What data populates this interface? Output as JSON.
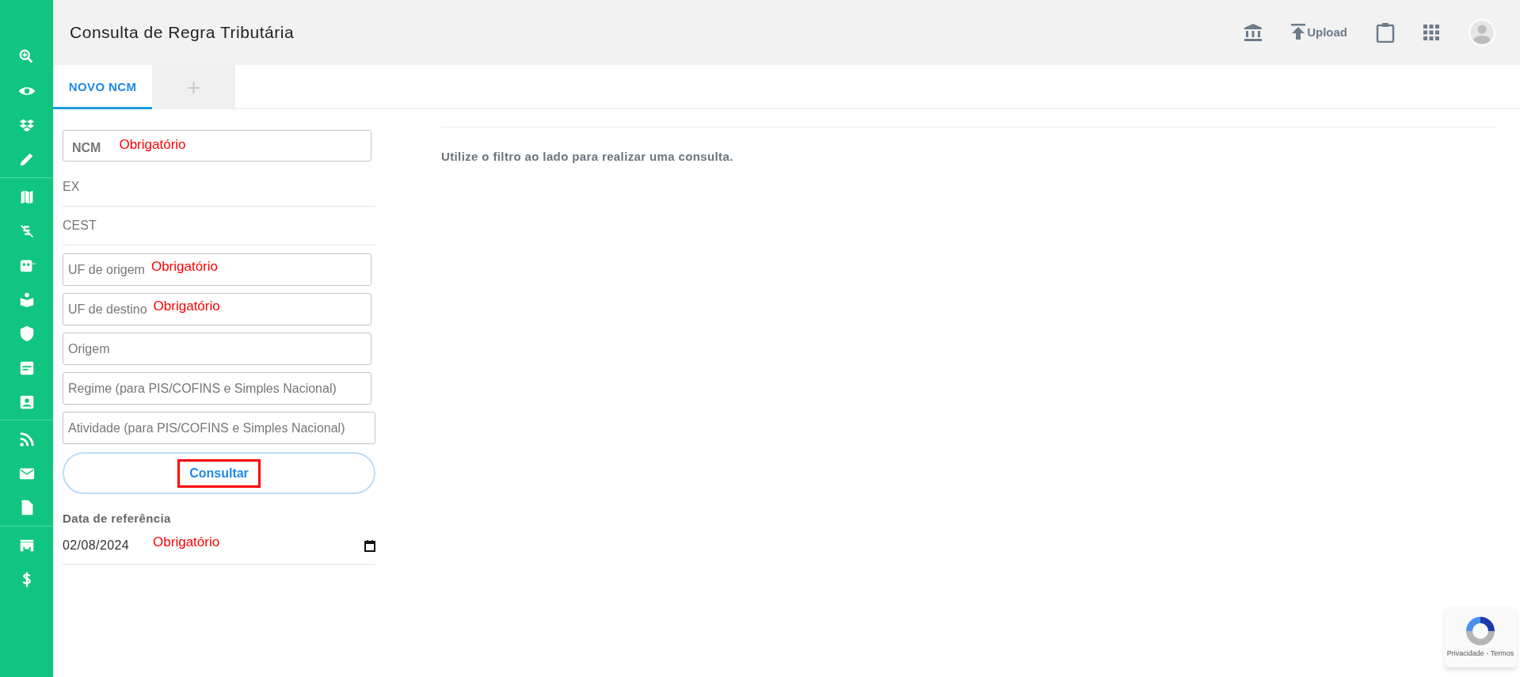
{
  "header": {
    "title": "Consulta de Regra Tributária",
    "upload_label": "Upload"
  },
  "tabs": [
    {
      "label": "NOVO NCM",
      "selected": true,
      "kind": "text"
    },
    {
      "label": "+",
      "selected": false,
      "kind": "add"
    }
  ],
  "form": {
    "fields": [
      {
        "kind": "outlined",
        "placeholder": "NCM",
        "annotation": "Obrigatório"
      },
      {
        "kind": "underline",
        "placeholder": "EX"
      },
      {
        "kind": "underline",
        "placeholder": "CEST"
      },
      {
        "kind": "outlined",
        "placeholder": "UF de origem",
        "annotation": "Obrigatório"
      },
      {
        "kind": "outlined",
        "placeholder": "UF de destino",
        "annotation": "Obrigatório"
      },
      {
        "kind": "outlined",
        "placeholder": "Origem"
      },
      {
        "kind": "outlined",
        "placeholder": "Regime (para PIS/COFINS e Simples Nacional)"
      },
      {
        "kind": "outlined",
        "placeholder": "Atividade (para PIS/COFINS e Simples Nacional)"
      }
    ],
    "submit": {
      "label": "Consultar",
      "highlighted": true
    },
    "date": {
      "label": "Data de referência",
      "value": "02/08/2024",
      "annotation": "Obrigatório"
    }
  },
  "results": {
    "message": "Utilize o filtro ao lado para realizar uma consulta."
  },
  "recaptcha": {
    "text": "Privacidade - Termos"
  }
}
